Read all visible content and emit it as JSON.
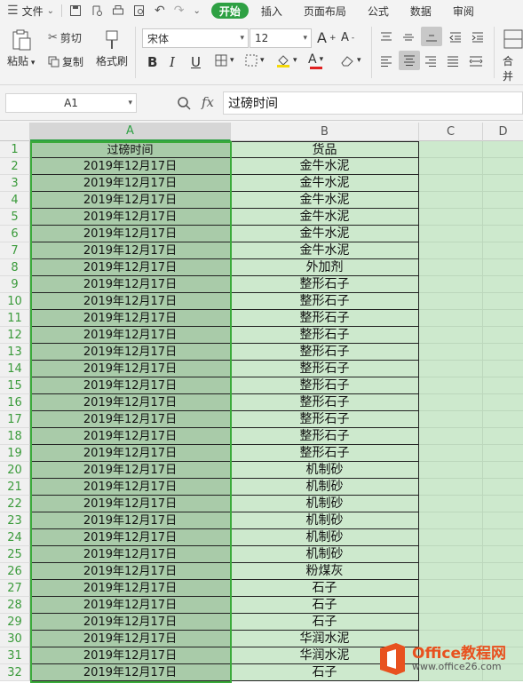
{
  "menubar": {
    "file": "文件",
    "tabs": [
      "开始",
      "插入",
      "页面布局",
      "公式",
      "数据",
      "审阅"
    ],
    "active_tab": "开始"
  },
  "ribbon": {
    "paste": "粘贴",
    "cut": "剪切",
    "copy": "复制",
    "format_painter": "格式刷",
    "font_name": "宋体",
    "font_size": "12",
    "merge": "合并"
  },
  "formula_bar": {
    "cell_ref": "A1",
    "fx": "fx",
    "content": "过磅时间"
  },
  "columns": [
    "A",
    "B",
    "C",
    "D"
  ],
  "sheet": {
    "rows": [
      [
        "过磅时间",
        "货品"
      ],
      [
        "2019年12月17日",
        "金牛水泥"
      ],
      [
        "2019年12月17日",
        "金牛水泥"
      ],
      [
        "2019年12月17日",
        "金牛水泥"
      ],
      [
        "2019年12月17日",
        "金牛水泥"
      ],
      [
        "2019年12月17日",
        "金牛水泥"
      ],
      [
        "2019年12月17日",
        "金牛水泥"
      ],
      [
        "2019年12月17日",
        "外加剂"
      ],
      [
        "2019年12月17日",
        "整形石子"
      ],
      [
        "2019年12月17日",
        "整形石子"
      ],
      [
        "2019年12月17日",
        "整形石子"
      ],
      [
        "2019年12月17日",
        "整形石子"
      ],
      [
        "2019年12月17日",
        "整形石子"
      ],
      [
        "2019年12月17日",
        "整形石子"
      ],
      [
        "2019年12月17日",
        "整形石子"
      ],
      [
        "2019年12月17日",
        "整形石子"
      ],
      [
        "2019年12月17日",
        "整形石子"
      ],
      [
        "2019年12月17日",
        "整形石子"
      ],
      [
        "2019年12月17日",
        "整形石子"
      ],
      [
        "2019年12月17日",
        "机制砂"
      ],
      [
        "2019年12月17日",
        "机制砂"
      ],
      [
        "2019年12月17日",
        "机制砂"
      ],
      [
        "2019年12月17日",
        "机制砂"
      ],
      [
        "2019年12月17日",
        "机制砂"
      ],
      [
        "2019年12月17日",
        "机制砂"
      ],
      [
        "2019年12月17日",
        "粉煤灰"
      ],
      [
        "2019年12月17日",
        "石子"
      ],
      [
        "2019年12月17日",
        "石子"
      ],
      [
        "2019年12月17日",
        "石子"
      ],
      [
        "2019年12月17日",
        "华润水泥"
      ],
      [
        "2019年12月17日",
        "华润水泥"
      ],
      [
        "2019年12月17日",
        "石子"
      ]
    ]
  },
  "watermark": {
    "line1": "Office教程网",
    "line2": "www.office26.com"
  },
  "colors": {
    "accent_green": "#2ea043",
    "sheet_green": "#cde9cd",
    "selected_col": "#a9cba9",
    "watermark_orange": "#e8511f"
  }
}
